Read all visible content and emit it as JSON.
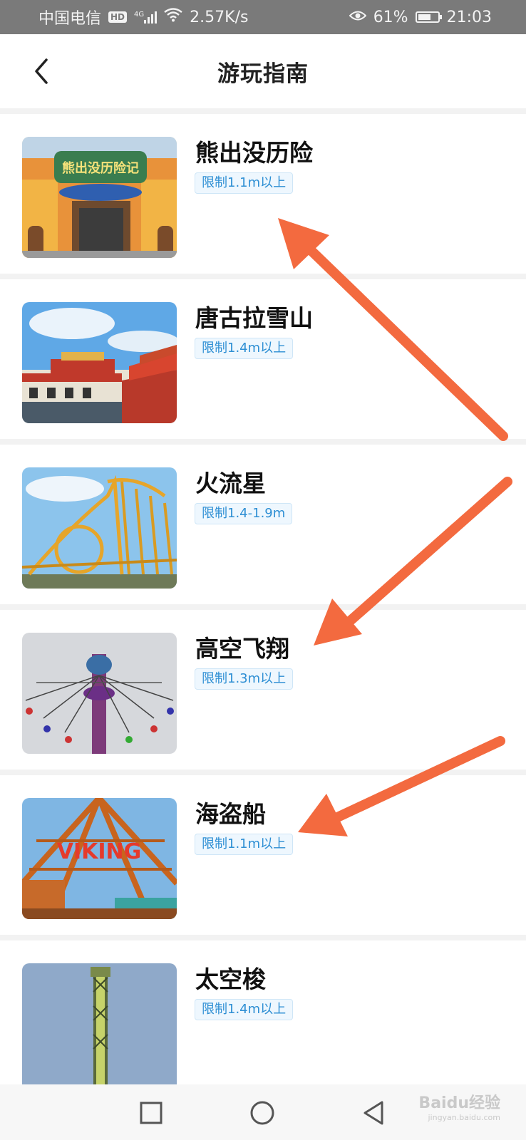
{
  "status_bar": {
    "carrier": "中国电信",
    "hd": "HD",
    "network": "4G",
    "speed": "2.57K/s",
    "battery": "61%",
    "time": "21:03"
  },
  "header": {
    "title": "游玩指南"
  },
  "rides": [
    {
      "name": "熊出没历险",
      "limit": "限制1.1m以上",
      "image": "bear-adventure-building"
    },
    {
      "name": "唐古拉雪山",
      "limit": "限制1.4m以上",
      "image": "tibetan-style-building"
    },
    {
      "name": "火流星",
      "limit": "限制1.4-1.9m",
      "image": "roller-coaster"
    },
    {
      "name": "高空飞翔",
      "limit": "限制1.3m以上",
      "image": "swing-ride-tower"
    },
    {
      "name": "海盗船",
      "limit": "限制1.1m以上",
      "image": "viking-ship-ride"
    },
    {
      "name": "太空梭",
      "limit": "限制1.4m以上",
      "image": "drop-tower"
    }
  ],
  "nav": {
    "icons": [
      "square-icon",
      "circle-icon",
      "back-triangle-icon"
    ]
  },
  "watermark": {
    "brand": "Baidu经验",
    "url": "jingyan.baidu.com"
  },
  "colors": {
    "badge_text": "#2e8fd4",
    "badge_bg": "#eef7fe",
    "arrow": "#f36a3f",
    "status_bar": "#7a7a7a"
  }
}
